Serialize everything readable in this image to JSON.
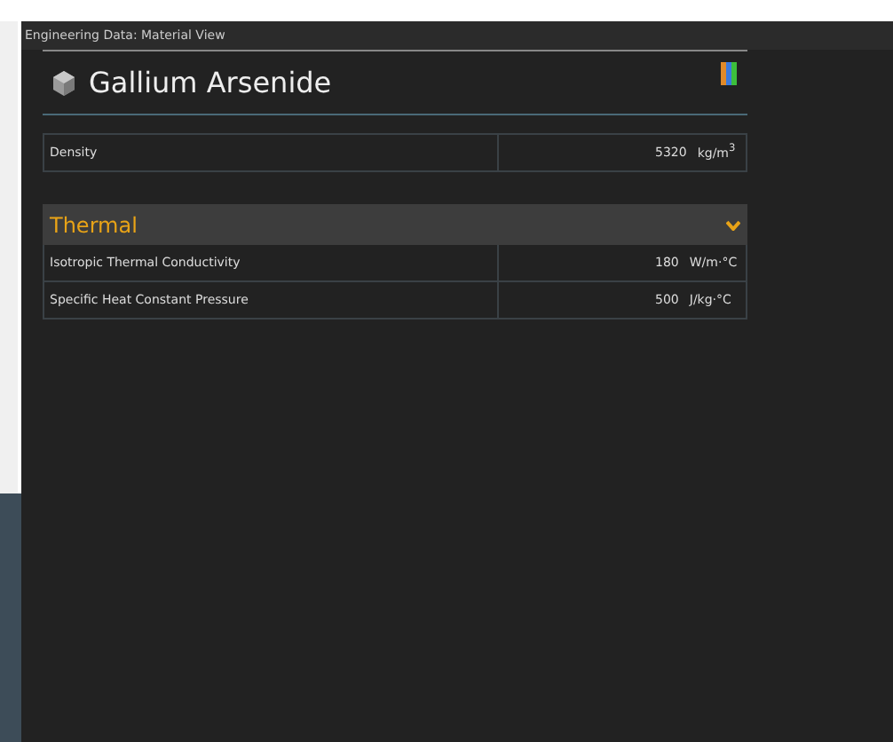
{
  "window": {
    "title": "Engineering Data: Material View"
  },
  "material": {
    "name": "Gallium Arsenide"
  },
  "properties": [
    {
      "name": "Density",
      "value": "5320",
      "unit": "kg/m$^{3}$"
    }
  ],
  "sections": [
    {
      "title": "Thermal",
      "expanded": true,
      "rows": [
        {
          "name": "Isotropic Thermal Conductivity",
          "value": "180",
          "unit": "W/m·°C"
        },
        {
          "name": "Specific Heat Constant Pressure",
          "value": "500",
          "unit": "J/kg·°C"
        }
      ]
    }
  ]
}
